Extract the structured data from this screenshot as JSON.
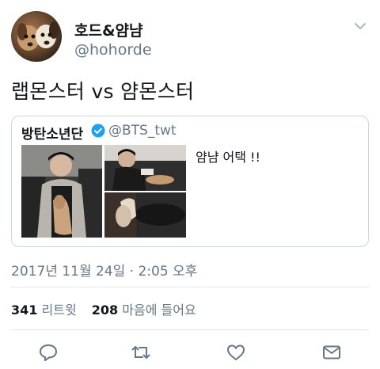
{
  "user": {
    "name": "호드&얌냠",
    "handle": "@hohorde"
  },
  "tweet": {
    "text": "랩몬스터 vs 얌몬스터",
    "timestamp": "2017년 11월 24일 · 2:05 오후"
  },
  "quoted": {
    "name": "방탄소년단",
    "handle": "@BTS_twt",
    "text": "얌냠 어택 !!",
    "verified": true
  },
  "stats": {
    "retweets_count": "341",
    "retweets_label": "리트윗",
    "likes_count": "208",
    "likes_label": "마음에 들어요"
  },
  "icons": {
    "menu": "chevron-down-icon",
    "verified": "verified-badge-icon",
    "reply": "reply-icon",
    "retweet": "retweet-icon",
    "like": "heart-icon",
    "message": "envelope-icon"
  },
  "colors": {
    "text": "#14171a",
    "secondary": "#657786",
    "verified": "#1da1f2",
    "border": "#ccd6dd"
  }
}
